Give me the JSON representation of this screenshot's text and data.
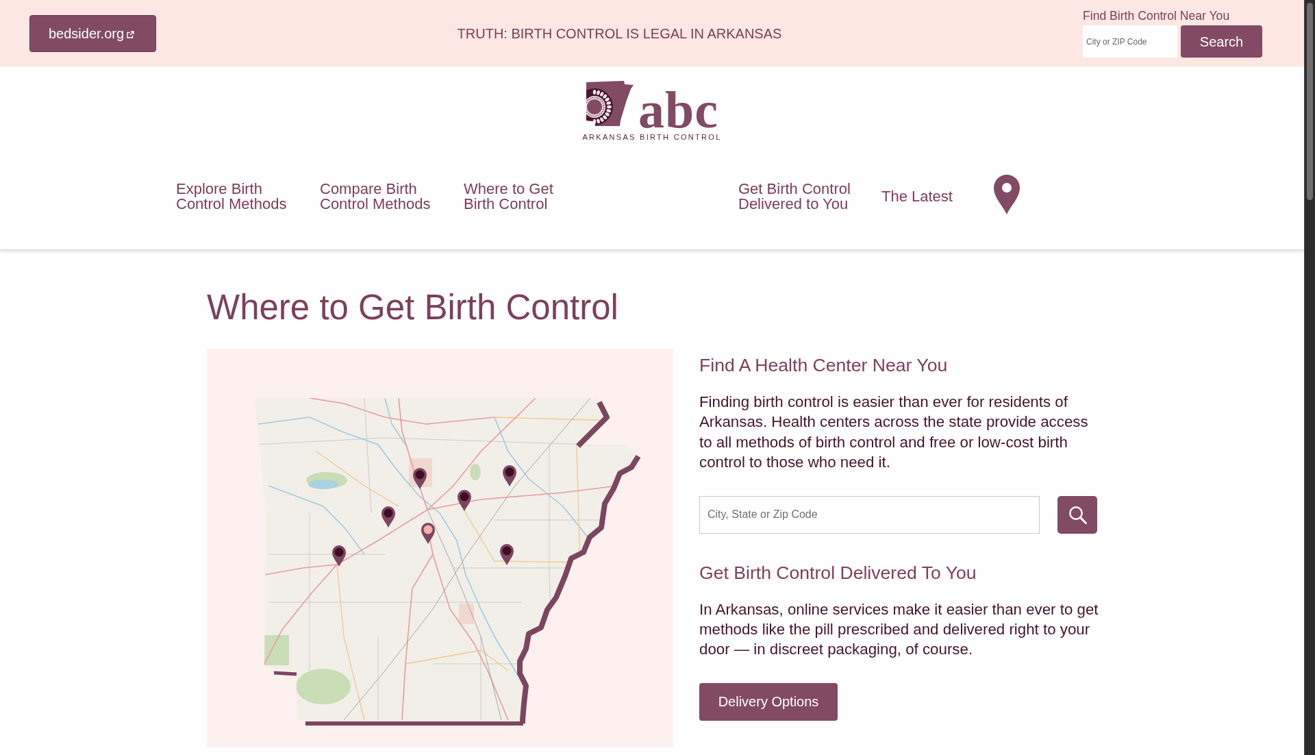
{
  "top_bar": {
    "partner_link": {
      "label": "bedsider.org"
    },
    "announcement": "TRUTH: BIRTH CONTROL IS LEGAL IN ARKANSAS",
    "locator": {
      "heading": "Find Birth Control Near You",
      "placeholder": "City or ZIP Code",
      "button": "Search"
    }
  },
  "header": {
    "logo": {
      "wordmark": "abc",
      "tagline": "ARKANSAS BIRTH CONTROL"
    },
    "nav": {
      "left_items": [
        {
          "label": "Explore Birth Control Methods"
        },
        {
          "label": "Compare Birth Control Methods"
        },
        {
          "label": "Where to Get Birth Control"
        }
      ],
      "right_items": [
        {
          "label": "Get Birth Control Delivered to You"
        },
        {
          "label": "The Latest"
        }
      ]
    }
  },
  "page_title": "Where to Get Birth Control",
  "sections": [
    {
      "kind": "search",
      "heading": "Find A Health Center Near You",
      "body": "Finding birth control is easier than ever for residents of Arkansas. Health centers across the state provide access to all methods of birth control and free or low-cost birth control to those who need it.",
      "placeholder": "City, State or Zip Code"
    },
    {
      "kind": "cta",
      "heading": "Get Birth Control Delivered To You",
      "body": "In Arkansas, online services make it easier than ever to get methods like the pill prescribed and delivered right to your door — in discreet packaging, of course.",
      "button": "Delivery Options"
    }
  ]
}
